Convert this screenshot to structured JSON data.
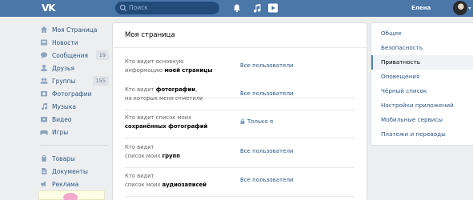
{
  "header": {
    "logo": "VK",
    "search_placeholder": "Поиск",
    "user_name": "Елена"
  },
  "nav": {
    "items": [
      {
        "label": "Моя Страница",
        "icon": "home-icon"
      },
      {
        "label": "Новости",
        "icon": "news-icon"
      },
      {
        "label": "Сообщения",
        "icon": "messages-icon",
        "count": "19"
      },
      {
        "label": "Друзья",
        "icon": "friends-icon"
      },
      {
        "label": "Группы",
        "icon": "groups-icon",
        "count": "155"
      },
      {
        "label": "Фотографии",
        "icon": "photos-icon"
      },
      {
        "label": "Музыка",
        "icon": "music-icon"
      },
      {
        "label": "Видео",
        "icon": "video-icon"
      },
      {
        "label": "Игры",
        "icon": "games-icon"
      }
    ],
    "extra_items": [
      {
        "label": "Товары",
        "icon": "goods-icon"
      },
      {
        "label": "Документы",
        "icon": "documents-icon"
      },
      {
        "label": "Реклама",
        "icon": "ads-icon"
      }
    ]
  },
  "main": {
    "title": "Моя страница",
    "rows": [
      {
        "q1": "Кто видит основную",
        "q2a": "информацию ",
        "q2b": "моей страницы",
        "answer": "Все пользователи"
      },
      {
        "q1a": "Кто видит ",
        "q1b": "фотографии",
        "q1c": ",",
        "q2": "на которых меня отметили",
        "answer": "Все пользователи"
      },
      {
        "q1": "Кто видит список моих",
        "q2b": "сохранённых фотографий",
        "answer": "Только я"
      },
      {
        "q1": "Кто видит",
        "q2a": "список моих ",
        "q2b": "групп",
        "answer": "Все пользователи"
      },
      {
        "q1": "Кто видит",
        "q2a": "список моих ",
        "q2b": "аудиозаписей",
        "answer": "Все пользователи"
      }
    ]
  },
  "menu": {
    "items": [
      "Общее",
      "Безопасность",
      "Приватность",
      "Оповещения",
      "Чёрный список",
      "Настройки приложений",
      "Мобильные сервисы",
      "Платежи и переводы"
    ],
    "active_index": 2
  },
  "colors": {
    "header": "#4a76a8",
    "link": "#2a5885",
    "background": "#edeef0"
  }
}
